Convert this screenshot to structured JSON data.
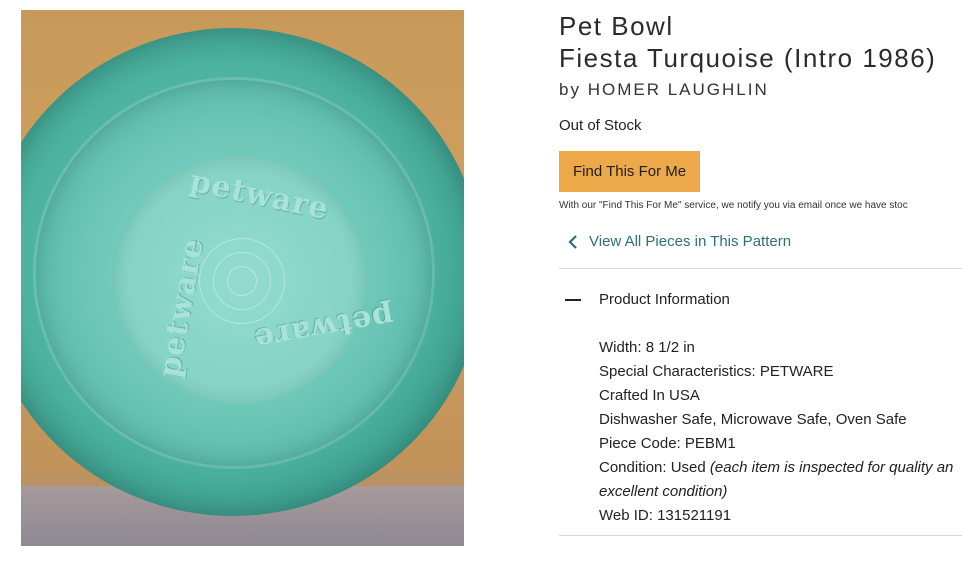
{
  "product": {
    "title_line1": "Pet Bowl",
    "title_line2": "Fiesta Turquoise (Intro 1986)",
    "brand_prefix": "by",
    "brand": "HOMER LAUGHLIN",
    "stock_status": "Out of Stock"
  },
  "photo": {
    "embossed_text": "petware"
  },
  "actions": {
    "find_button": "Find This For Me",
    "find_notice": "With our \"Find This For Me\" service, we notify you via email once we have stoc",
    "view_all": "View All Pieces in This Pattern"
  },
  "section": {
    "title": "Product Information"
  },
  "specs": [
    {
      "label": "Width:",
      "value": "8 1/2 in"
    },
    {
      "label": "Special Characteristics:",
      "value": "PETWARE"
    },
    {
      "label": "Crafted In USA",
      "value": ""
    },
    {
      "label": "Dishwasher Safe, Microwave Safe, Oven Safe",
      "value": ""
    },
    {
      "label": "Piece Code:",
      "value": "PEBM1"
    },
    {
      "label": "Condition:",
      "value": "Used",
      "note": "(each item is inspected for quality an excellent condition)"
    },
    {
      "label": "Web ID:",
      "value": "131521191"
    }
  ],
  "colors": {
    "button_bg": "#eda849",
    "link": "#2e6f7a",
    "bowl": "#5fbfae"
  }
}
